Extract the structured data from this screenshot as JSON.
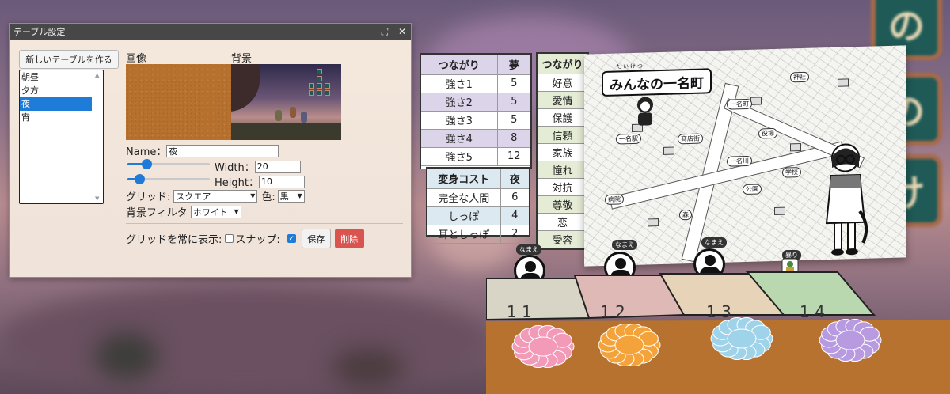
{
  "background_tiles": [
    "の",
    "の",
    "け"
  ],
  "dialog": {
    "title": "テーブル設定",
    "new_table_button": "新しいテーブルを作る",
    "tables": [
      {
        "label": "朝昼",
        "selected": false
      },
      {
        "label": "夕方",
        "selected": false
      },
      {
        "label": "夜",
        "selected": true
      },
      {
        "label": "宵",
        "selected": false
      }
    ],
    "image_label": "画像",
    "background_label": "背景",
    "name_label": "Name：",
    "name_value": "夜",
    "width_label": "Width：",
    "width_value": "20",
    "height_label": "Height：",
    "height_value": "10",
    "width_slider_level": 0.2,
    "height_slider_level": 0.1,
    "grid_label": "グリッド:",
    "grid_value": "スクエア",
    "color_label": "色:",
    "color_value": "黒",
    "filter_label": "背景フィルタ",
    "filter_value": "ホワイト",
    "always_show_grid_label": "グリッドを常に表示:",
    "always_show_grid_checked": false,
    "snap_label": "スナップ:",
    "snap_checked": true,
    "save_button": "保存",
    "delete_button": "削除",
    "accent_color": "#1e7bd8",
    "delete_color": "#d9534f"
  },
  "strength_table": {
    "headers": [
      "つながり",
      "夢"
    ],
    "rows": [
      [
        "強さ1",
        "5"
      ],
      [
        "強さ2",
        "5"
      ],
      [
        "強さ3",
        "5"
      ],
      [
        "強さ4",
        "8"
      ],
      [
        "強さ5",
        "12"
      ]
    ]
  },
  "cost_table": {
    "headers": [
      "変身コスト",
      "夜"
    ],
    "rows": [
      [
        "完全な人間",
        "6"
      ],
      [
        "しっぽ",
        "4"
      ],
      [
        "耳としっぽ",
        "2"
      ]
    ]
  },
  "bond_list": {
    "header": "つながり",
    "items": [
      "好意",
      "愛情",
      "保護",
      "信頼",
      "家族",
      "憧れ",
      "対抗",
      "尊敬",
      "恋",
      "受容"
    ]
  },
  "map_card": {
    "title": "みんなの一名町",
    "furigana": "たいけつ",
    "labels": [
      "一名町",
      "一名駅",
      "商店街",
      "学校",
      "神社",
      "公園",
      "病院",
      "一名川",
      "役場",
      "森"
    ]
  },
  "tokens": [
    {
      "name": "なまえ"
    },
    {
      "name": "なまえ"
    },
    {
      "name": "なまえ"
    },
    {
      "name": "暴り"
    }
  ],
  "board_cards": [
    "1 1",
    "1 2",
    "1 3",
    "1 4"
  ],
  "flower_colors": [
    "#f29ab8",
    "#f4a23a",
    "#9fd3ea",
    "#b79ae0"
  ],
  "zone_colors": [
    "#d9d5c6",
    "#dfb9b5",
    "#e6d3b8",
    "#b9d8b0"
  ]
}
